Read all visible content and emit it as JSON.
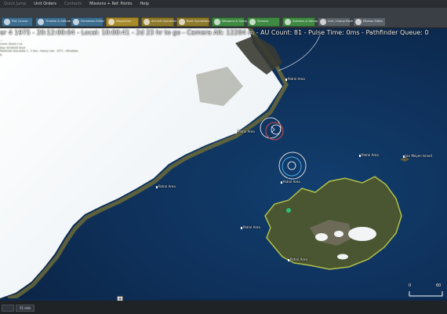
{
  "menu": {
    "items": [
      {
        "label": "Quick Jump",
        "dim": true
      },
      {
        "label": "Unit Orders",
        "dim": false
      },
      {
        "label": "Contacts",
        "dim": true
      },
      {
        "label": "Missions + Ref. Points",
        "dim": false
      },
      {
        "label": "Help",
        "dim": false
      }
    ]
  },
  "toolbar": {
    "buttons": [
      {
        "label": "Plot Course",
        "color": "#3d6d8f"
      },
      {
        "label": "Throttle & Altitude",
        "color": "#3d6d8f"
      },
      {
        "label": "Formation Editor",
        "color": "#3d6d8f"
      },
      {
        "label": "Magazines",
        "color": "#a88a2a"
      },
      {
        "label": "Aircraft Operations",
        "color": "#8e7a2a"
      },
      {
        "label": "Boat Operations",
        "color": "#8e7a2a"
      },
      {
        "label": "Weapons & Sensors",
        "color": "#3f8a43"
      },
      {
        "label": "Sensors",
        "color": "#3f8a43"
      },
      {
        "label": "Systems & Damage",
        "color": "#3f8a43"
      },
      {
        "label": "Unit / Group Doctrine",
        "color": "#5a6168"
      },
      {
        "label": "Mission Editor",
        "color": "#5a6168"
      }
    ]
  },
  "status": {
    "line": "er 4 1975 - 20:12:00:04 - Local: 10:00:41 - 2d 23 hr to go - Camera Alt: 12284 m - AU Count: 81 - Pulse Time: 0ms - Pathfinder Queue: 0"
  },
  "info": {
    "lines": [
      "...",
      "Level: Seven / na",
      "Day: 03:00:00 Start",
      "Moderate Sea-state 1 - 2 Sea - Heavy rain - 23°C - Wind/Sea 6"
    ]
  },
  "map": {
    "labels": {
      "jan_mayen": "Jan Mayen Island",
      "patrol_1": "Patrol Area",
      "patrol_2": "Patrol Area",
      "patrol_3": "Patrol Area",
      "patrol_4": "Patrol Area",
      "patrol_5": "Patrol Area",
      "patrol_6": "Patrol Area",
      "patrol_7": "Patrol Area"
    }
  },
  "bottom": {
    "tab1": "",
    "tab2": "15 mils"
  },
  "scale": {
    "left": "0",
    "right": "60"
  }
}
